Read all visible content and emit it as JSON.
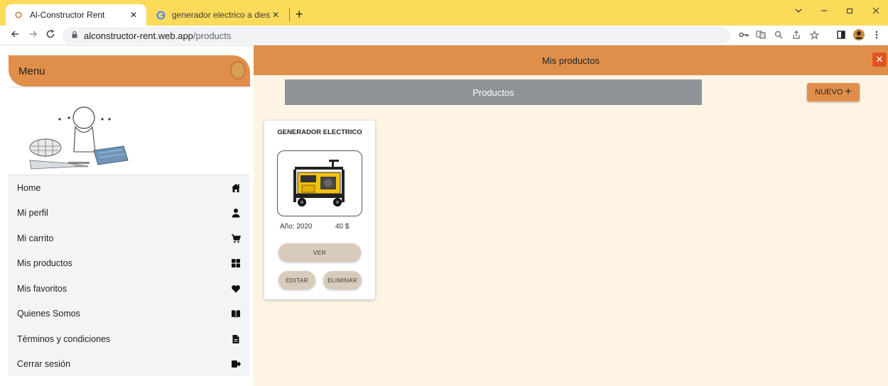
{
  "browser": {
    "tabs": [
      {
        "title": "Al-Constructor Rent",
        "close": "✕"
      },
      {
        "title": "generador electrico a diesel - Bú",
        "close": "✕"
      }
    ],
    "new_tab": "+",
    "url_host": "alconstructor-rent.web.app",
    "url_path": "/products"
  },
  "sidebar": {
    "menu_title": "Menu",
    "items": [
      {
        "label": "Home",
        "icon": "home-icon"
      },
      {
        "label": "Mi perfil",
        "icon": "user-icon"
      },
      {
        "label": "Mi carrito",
        "icon": "cart-icon"
      },
      {
        "label": "Mis productos",
        "icon": "grid-icon"
      },
      {
        "label": "Mis favoritos",
        "icon": "heart-icon"
      },
      {
        "label": "Quienes Somos",
        "icon": "book-icon"
      },
      {
        "label": "Términos y condiciones",
        "icon": "document-icon"
      },
      {
        "label": "Cerrar sesión",
        "icon": "logout-icon"
      }
    ]
  },
  "main": {
    "title": "Mis productos",
    "close": "✕",
    "products_bar": "Productos",
    "new_button": "NUEVO",
    "new_button_icon": "+",
    "products": [
      {
        "name": "GENERADOR ELECTRICO",
        "year": "Año: 2020",
        "price": "40 $",
        "view": "VER",
        "edit": "EDITAR",
        "delete": "ELIMINAR"
      }
    ]
  },
  "colors": {
    "accent": "#e08f4b",
    "tabbar": "#fddb5a",
    "main_bg": "#fdf4e4",
    "products_bar": "#8f9398",
    "pill": "#d9cbbb",
    "close": "#e0541e"
  }
}
